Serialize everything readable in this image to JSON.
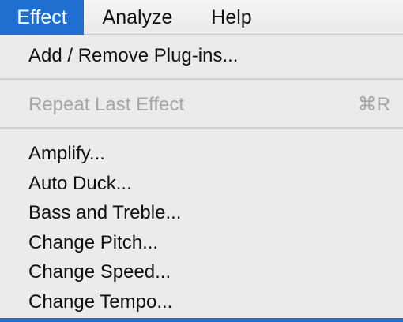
{
  "menubar": {
    "items": [
      {
        "label": "Effect",
        "active": true
      },
      {
        "label": "Analyze",
        "active": false
      },
      {
        "label": "Help",
        "active": false
      }
    ]
  },
  "dropdown": {
    "add_remove": "Add / Remove Plug-ins...",
    "repeat_last": {
      "label": "Repeat Last Effect",
      "shortcut": "⌘R",
      "disabled": true
    },
    "effects": [
      "Amplify...",
      "Auto Duck...",
      "Bass and Treble...",
      "Change Pitch...",
      "Change Speed...",
      "Change Tempo..."
    ]
  },
  "colors": {
    "highlight": "#1f6fd1",
    "menu_background": "#ebebeb",
    "disabled_text": "#a6a6a6"
  }
}
